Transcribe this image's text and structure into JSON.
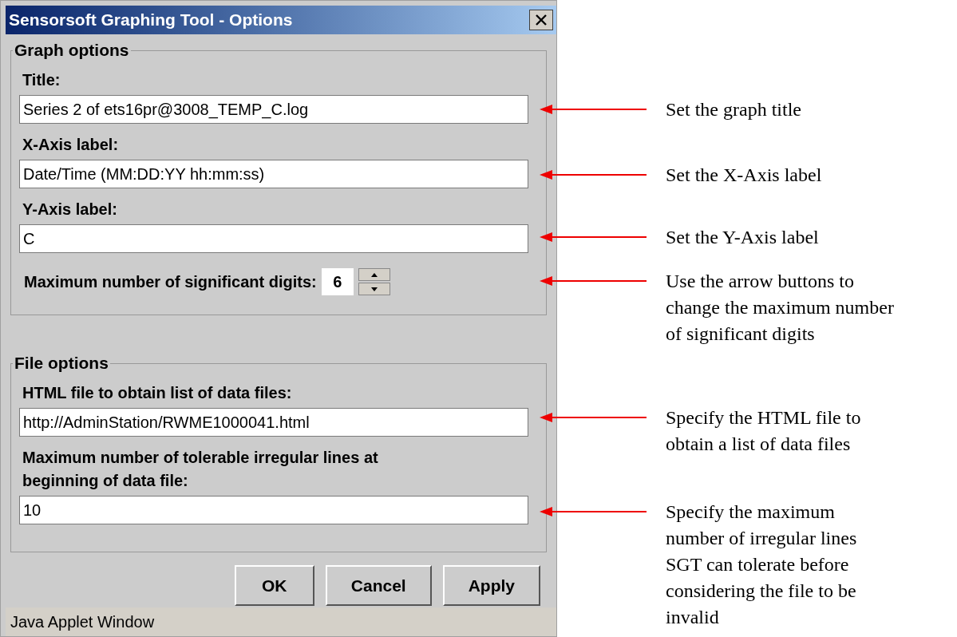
{
  "window": {
    "title": "Sensorsoft Graphing Tool - Options"
  },
  "groups": [
    {
      "legend": "Graph options",
      "fields": [
        {
          "kind": "text",
          "label": "Title:",
          "value": "Series 2 of ets16pr@3008_TEMP_C.log"
        },
        {
          "kind": "text",
          "label": "X-Axis label:",
          "value": "Date/Time (MM:DD:YY hh:mm:ss)"
        },
        {
          "kind": "text",
          "label": "Y-Axis label:",
          "value": "C"
        },
        {
          "kind": "spinner",
          "label": "Maximum number of significant digits:",
          "value": "6"
        }
      ]
    },
    {
      "legend": "File options",
      "fields": [
        {
          "kind": "text",
          "label": "HTML file to obtain list of data files:",
          "value": "http://AdminStation/RWME1000041.html"
        },
        {
          "kind": "text",
          "label": "Maximum number of tolerable irregular lines at beginning of data file:",
          "value": "10"
        }
      ]
    }
  ],
  "buttons": [
    "OK",
    "Cancel",
    "Apply"
  ],
  "status_bar": "Java Applet Window",
  "annotations": [
    {
      "lines": [
        "Set the graph title"
      ]
    },
    {
      "lines": [
        "Set the X-Axis label"
      ]
    },
    {
      "lines": [
        "Set the Y-Axis label"
      ]
    },
    {
      "lines": [
        "Use the arrow buttons to",
        "change the maximum number",
        "of significant digits"
      ]
    },
    {
      "lines": [
        "Specify the HTML file to",
        "obtain a list of data files"
      ]
    },
    {
      "lines": [
        "Specify the maximum",
        "number of irregular lines",
        "SGT can tolerate before",
        "considering the file to be",
        "invalid"
      ]
    }
  ]
}
